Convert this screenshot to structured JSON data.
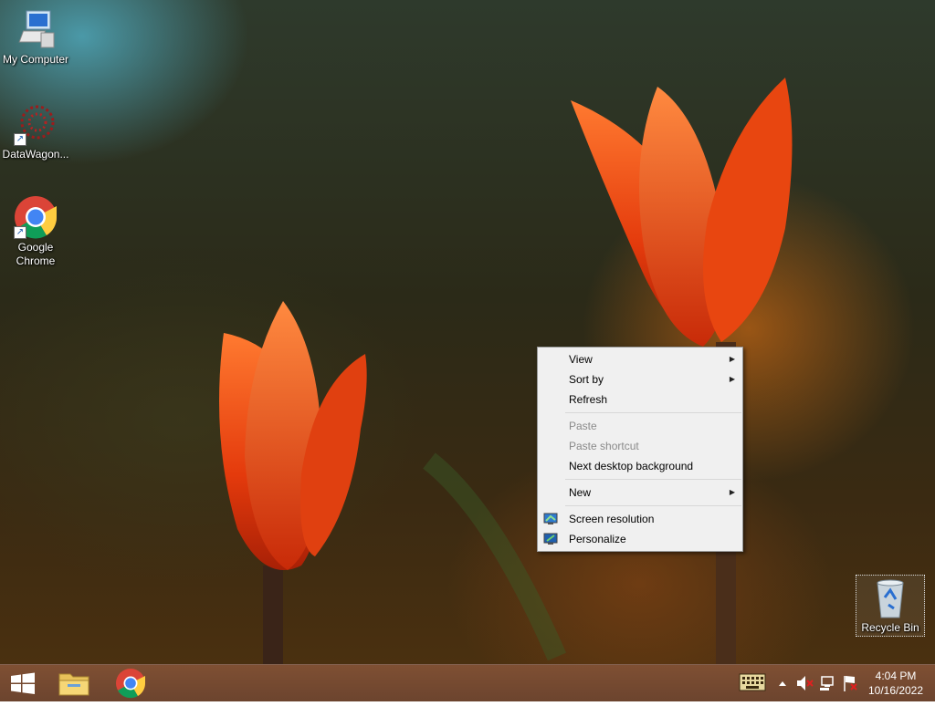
{
  "desktop_icons": [
    {
      "name": "my-computer",
      "label": "My Computer",
      "icon": "computer-icon"
    },
    {
      "name": "datawagon",
      "label": "DataWagon...",
      "icon": "datawagon-icon"
    },
    {
      "name": "google-chrome",
      "label": "Google Chrome",
      "icon": "chrome-icon"
    },
    {
      "name": "recycle-bin",
      "label": "Recycle Bin",
      "icon": "recycle-bin-icon"
    }
  ],
  "context_menu": {
    "items": [
      {
        "label": "View",
        "submenu": true,
        "enabled": true
      },
      {
        "label": "Sort by",
        "submenu": true,
        "enabled": true
      },
      {
        "label": "Refresh",
        "submenu": false,
        "enabled": true
      },
      {
        "label": "Paste",
        "submenu": false,
        "enabled": false
      },
      {
        "label": "Paste shortcut",
        "submenu": false,
        "enabled": false
      },
      {
        "label": "Next desktop background",
        "submenu": false,
        "enabled": true
      },
      {
        "label": "New",
        "submenu": true,
        "enabled": true
      },
      {
        "label": "Screen resolution",
        "submenu": false,
        "enabled": true,
        "icon": "screen-resolution-icon"
      },
      {
        "label": "Personalize",
        "submenu": false,
        "enabled": true,
        "icon": "personalize-icon"
      }
    ]
  },
  "taskbar": {
    "pinned": [
      "windows-start-icon",
      "file-explorer-icon",
      "chrome-icon"
    ],
    "tray_icons": [
      "keyboard-icon",
      "show-hidden-icons-chevron",
      "speaker-muted-icon",
      "network-icon",
      "action-center-flag-icon"
    ],
    "clock": {
      "time": "4:04 PM",
      "date": "10/16/2022"
    }
  },
  "colors": {
    "menu_bg": "#f0f0f0",
    "taskbar": "#6e4028",
    "tulip": "#e84a10"
  }
}
